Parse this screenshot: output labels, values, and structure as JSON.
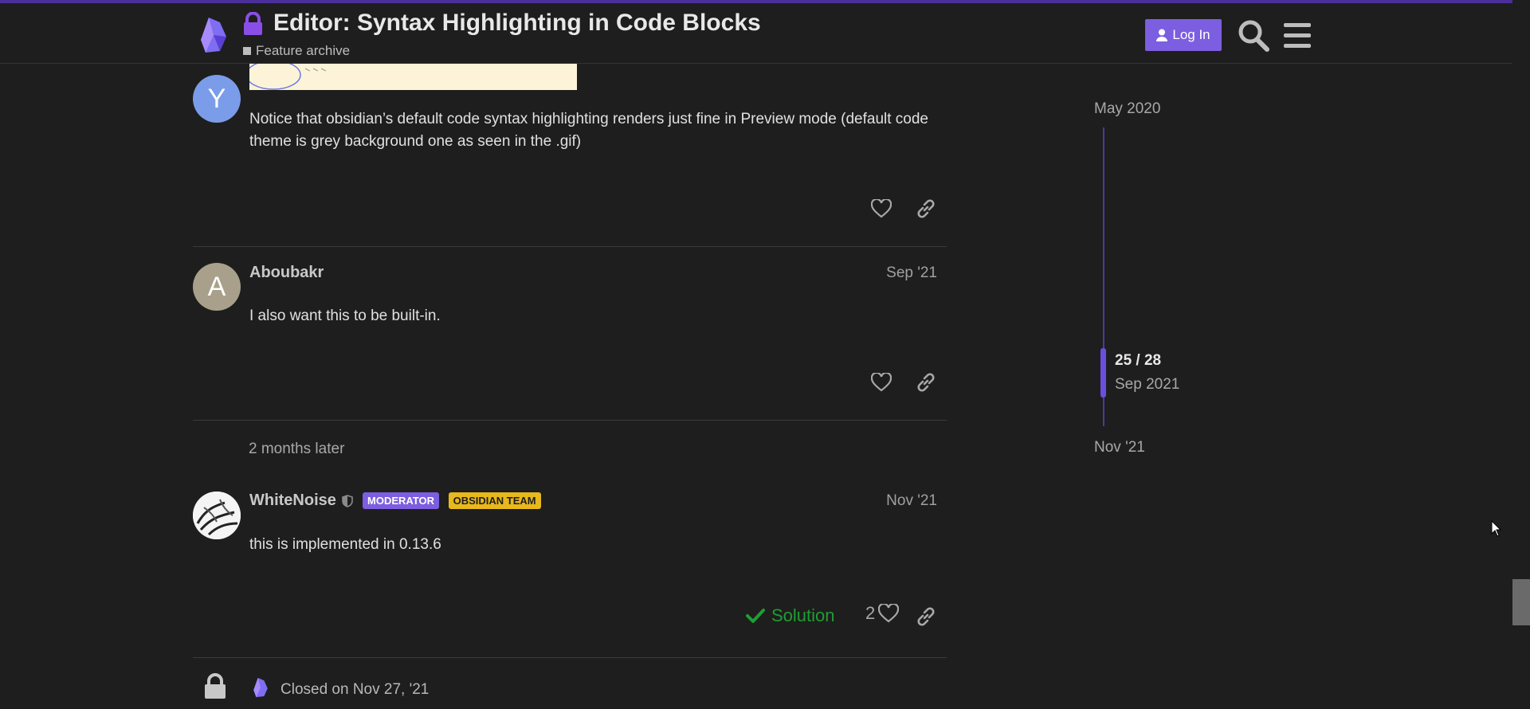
{
  "header": {
    "title": "Editor: Syntax Highlighting in Code Blocks",
    "category": "Feature archive",
    "login_label": "Log In"
  },
  "posts": [
    {
      "avatar_letter": "Y",
      "avatar_color": "#7b9ce8",
      "body": "Notice that obsidian’s default code syntax highlighting renders just fine in Preview mode (default code theme is grey background one as seen in the .gif)"
    },
    {
      "avatar_letter": "A",
      "avatar_color": "#a8a08a",
      "username": "Aboubakr",
      "date": "Sep '21",
      "body": "I also want this to be built-in."
    },
    {
      "username": "WhiteNoise",
      "badges": [
        "MODERATOR",
        "OBSIDIAN TEAM"
      ],
      "date": "Nov '21",
      "body": "this is implemented in 0.13.6",
      "solution_label": "Solution",
      "like_count": "2"
    }
  ],
  "gap_label": "2 months later",
  "closed_label": "Closed on Nov 27, '21",
  "timeline": {
    "start": "May 2020",
    "position": "25 / 28",
    "current_date": "Sep 2021",
    "end": "Nov '21"
  },
  "colors": {
    "accent": "#7c5ee0",
    "team_badge": "#e8b81c",
    "solution": "#1f9e32",
    "background": "#1e1e1e"
  }
}
